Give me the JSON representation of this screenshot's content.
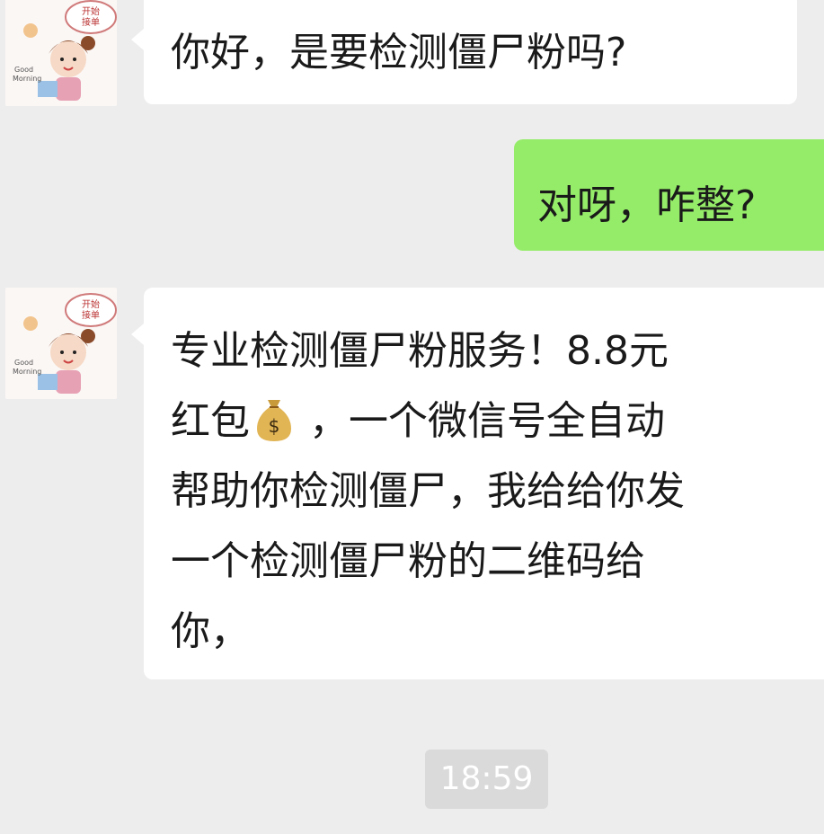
{
  "chat": {
    "messages": [
      {
        "sender": "contact",
        "lines": [
          "你好，是要检测僵尸粉吗?"
        ]
      },
      {
        "sender": "self",
        "lines": [
          "对呀，咋整?"
        ]
      },
      {
        "sender": "contact",
        "lines": [
          "专业检测僵尸粉服务！8.8元",
          "红包",
          "，一个微信号全自动",
          "帮助你检测僵尸，我给给你发",
          "一个检测僵尸粉的二维码给",
          "你，"
        ]
      }
    ],
    "timestamp": "18:59",
    "emoji": "money-bag-icon"
  },
  "avatar": {
    "badge_text": "开始\n接单"
  },
  "colors": {
    "background": "#ededed",
    "incoming_bubble": "#ffffff",
    "outgoing_bubble": "#95ec69",
    "timestamp_bg": "#dadada"
  }
}
